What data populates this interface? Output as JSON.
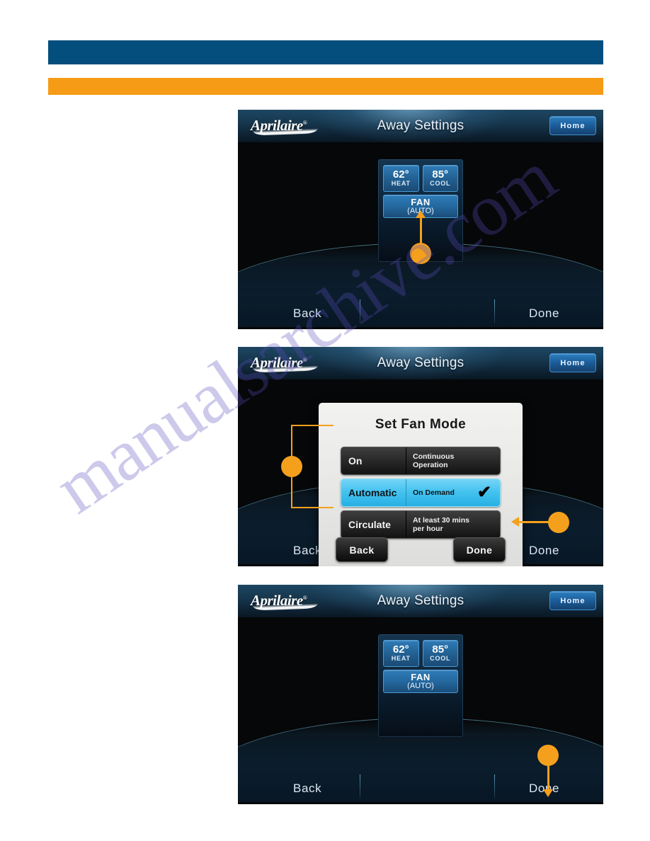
{
  "page": {
    "watermark_text": "manualsarchive.com",
    "accent_blue": "#034E7D",
    "accent_orange": "#F59B15",
    "callout_orange": "#F5A01D"
  },
  "bars": {
    "blue_bar_label": "",
    "orange_bar_label": ""
  },
  "screens": [
    {
      "id": "screen-away-settings-fan-callout",
      "header": {
        "logo_text": "Aprilaire",
        "logo_registered": "®",
        "title": "Away Settings",
        "home_button": "Home"
      },
      "panel": {
        "heat_temp": "62°",
        "heat_label": "HEAT",
        "cool_temp": "85°",
        "cool_label": "COOL",
        "fan_line1": "FAN",
        "fan_line2": "(AUTO)"
      },
      "nav": {
        "back": "Back",
        "done": "Done"
      },
      "callout": "arrow-up-to-fan-button"
    },
    {
      "id": "screen-set-fan-mode-dialog",
      "header": {
        "logo_text": "Aprilaire",
        "logo_registered": "®",
        "title": "Away Settings",
        "home_button": "Home"
      },
      "dialog": {
        "title": "Set Fan Mode",
        "options": [
          {
            "name": "On",
            "desc": "Continuous Operation",
            "desc_line1": "Continuous",
            "desc_line2": "Operation",
            "selected": false,
            "check": ""
          },
          {
            "name": "Automatic",
            "desc": "On Demand",
            "desc_line1": "On Demand",
            "desc_line2": "",
            "selected": true,
            "check": "✔"
          },
          {
            "name": "Circulate",
            "desc": "At least 30 mins per hour",
            "desc_line1": "At least 30 mins",
            "desc_line2": "per hour",
            "selected": false,
            "check": ""
          }
        ],
        "back_button": "Back",
        "done_button": "Done"
      },
      "nav": {
        "back": "Back",
        "done": "Done"
      },
      "callouts": [
        "bracket-around-option-list",
        "arrow-left-to-dialog-done"
      ]
    },
    {
      "id": "screen-away-settings-done-callout",
      "header": {
        "logo_text": "Aprilaire",
        "logo_registered": "®",
        "title": "Away Settings",
        "home_button": "Home"
      },
      "panel": {
        "heat_temp": "62°",
        "heat_label": "HEAT",
        "cool_temp": "85°",
        "cool_label": "COOL",
        "fan_line1": "FAN",
        "fan_line2": "(AUTO)"
      },
      "nav": {
        "back": "Back",
        "done": "Done"
      },
      "callout": "arrow-down-to-done"
    }
  ]
}
